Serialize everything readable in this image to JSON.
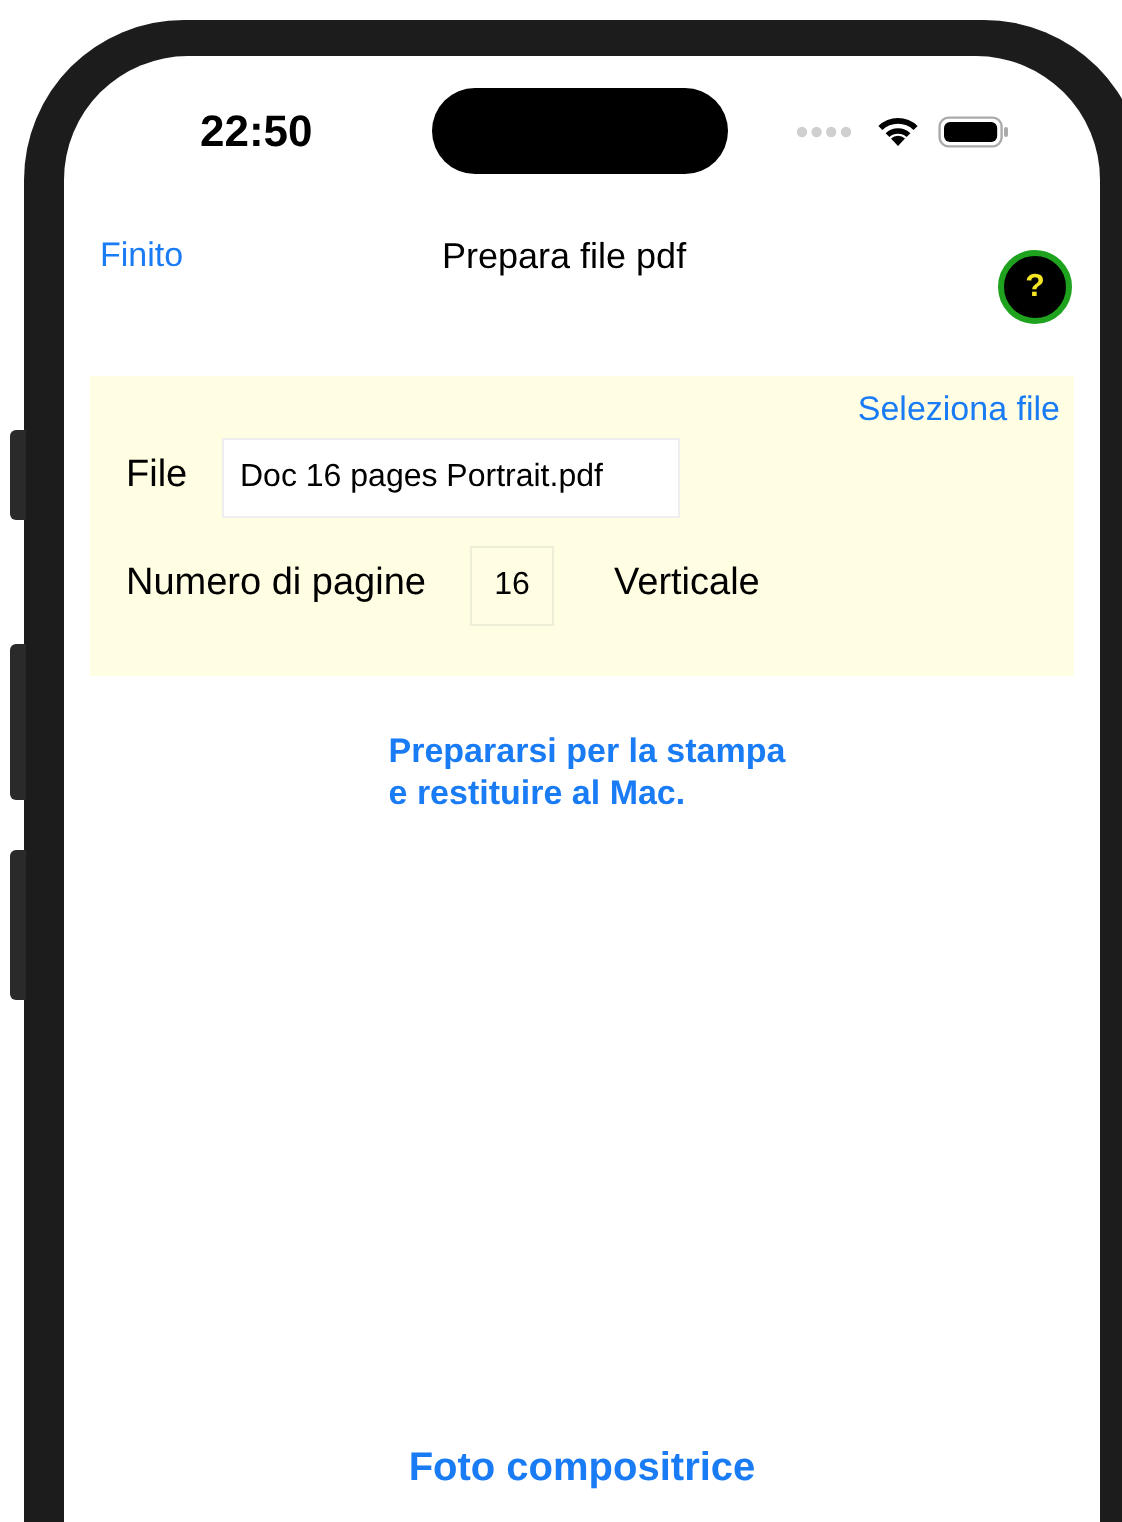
{
  "status_bar": {
    "time": "22:50"
  },
  "nav": {
    "left_button": "Finito",
    "title": "Prepara file pdf",
    "help_button": "?"
  },
  "panel": {
    "select_button": "Seleziona file",
    "file_label": "File",
    "file_value": "Doc 16 pages Portrait.pdf",
    "pages_label": "Numero di pagine",
    "pages_value": "16",
    "orientation": "Verticale"
  },
  "prepare_link": "Prepararsi per la stampa\ne restituire al Mac.",
  "photo_button": "Foto compositrice"
}
